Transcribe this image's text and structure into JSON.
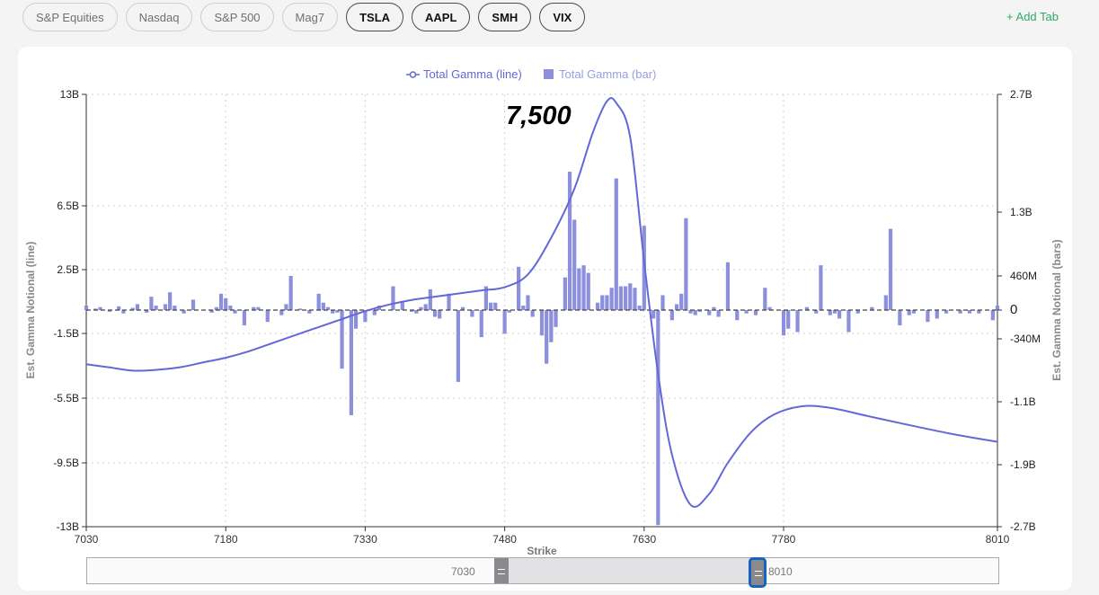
{
  "tabs": [
    {
      "label": "S&P Equities",
      "active": false
    },
    {
      "label": "Nasdaq",
      "active": false
    },
    {
      "label": "S&P 500",
      "active": false
    },
    {
      "label": "Mag7",
      "active": false
    },
    {
      "label": "TSLA",
      "active": true
    },
    {
      "label": "AAPL",
      "active": true
    },
    {
      "label": "SMH",
      "active": true
    },
    {
      "label": "VIX",
      "active": true
    }
  ],
  "add_tab_label": "+ Add Tab",
  "peak_label": "7,500",
  "slider": {
    "min_label": "7030",
    "max_label": "8010"
  },
  "colors": {
    "line": "#6468d6",
    "bar": "#8b8fdc",
    "zero_line": "#444444",
    "grid": "#cfcfd6",
    "add_tab": "#2ea86b"
  },
  "chart_data": {
    "type": "bar+line",
    "legend": [
      "Total Gamma (line)",
      "Total Gamma (bar)"
    ],
    "legend_position": "top-center",
    "xlabel": "Strike",
    "ylabel_left": "Est. Gamma Notional (line)",
    "ylabel_right": "Est. Gamma Notional (bars)",
    "x_ticks": [
      7030,
      7180,
      7330,
      7480,
      7630,
      7780,
      8010
    ],
    "xlim": [
      7030,
      8010
    ],
    "left_ticks": [
      {
        "v": 13,
        "label": "13B"
      },
      {
        "v": 6.5,
        "label": "6.5B"
      },
      {
        "v": 2.5,
        "label": "2.5B"
      },
      {
        "v": -1.5,
        "label": "-1.5B"
      },
      {
        "v": -5.5,
        "label": "-5.5B"
      },
      {
        "v": -9.5,
        "label": "-9.5B"
      },
      {
        "v": -13,
        "label": "-13B"
      }
    ],
    "right_ticks": [
      {
        "v": 2.7,
        "label": "2.7B"
      },
      {
        "v": 1.3,
        "label": "1.3B"
      },
      {
        "v": 0.46,
        "label": "460M"
      },
      {
        "v": 0,
        "label": "0"
      },
      {
        "v": -0.34,
        "label": "-340M"
      },
      {
        "v": -1.1,
        "label": "-1.1B"
      },
      {
        "v": -1.9,
        "label": "-1.9B"
      },
      {
        "v": -2.7,
        "label": "-2.7B"
      }
    ],
    "grid": "dotted",
    "line_series": {
      "name": "Total Gamma (line)",
      "points": [
        [
          7030,
          -3.4
        ],
        [
          7055,
          -3.6
        ],
        [
          7080,
          -3.8
        ],
        [
          7105,
          -3.75
        ],
        [
          7130,
          -3.6
        ],
        [
          7155,
          -3.3
        ],
        [
          7180,
          -3.0
        ],
        [
          7205,
          -2.6
        ],
        [
          7230,
          -2.1
        ],
        [
          7255,
          -1.6
        ],
        [
          7280,
          -1.1
        ],
        [
          7305,
          -0.6
        ],
        [
          7330,
          -0.1
        ],
        [
          7355,
          0.3
        ],
        [
          7380,
          0.6
        ],
        [
          7405,
          0.8
        ],
        [
          7430,
          1.0
        ],
        [
          7455,
          1.2
        ],
        [
          7480,
          1.4
        ],
        [
          7505,
          2.2
        ],
        [
          7530,
          4.5
        ],
        [
          7555,
          7.5
        ],
        [
          7575,
          10.8
        ],
        [
          7590,
          12.6
        ],
        [
          7600,
          12.5
        ],
        [
          7615,
          10.5
        ],
        [
          7630,
          3.0
        ],
        [
          7645,
          -4.0
        ],
        [
          7660,
          -9.0
        ],
        [
          7680,
          -11.8
        ],
        [
          7700,
          -11.2
        ],
        [
          7720,
          -9.5
        ],
        [
          7745,
          -7.6
        ],
        [
          7770,
          -6.5
        ],
        [
          7800,
          -6.0
        ],
        [
          7830,
          -6.1
        ],
        [
          7870,
          -6.6
        ],
        [
          7910,
          -7.1
        ],
        [
          7960,
          -7.7
        ],
        [
          8010,
          -8.2
        ]
      ]
    },
    "bar_series": {
      "name": "Total Gamma (bar)",
      "points": [
        [
          7030,
          0.06
        ],
        [
          7040,
          0.02
        ],
        [
          7045,
          0.04
        ],
        [
          7055,
          -0.02
        ],
        [
          7065,
          0.05
        ],
        [
          7070,
          -0.04
        ],
        [
          7080,
          0.03
        ],
        [
          7085,
          0.08
        ],
        [
          7095,
          -0.03
        ],
        [
          7100,
          0.18
        ],
        [
          7105,
          0.06
        ],
        [
          7115,
          0.08
        ],
        [
          7120,
          0.24
        ],
        [
          7125,
          0.06
        ],
        [
          7135,
          -0.04
        ],
        [
          7145,
          0.14
        ],
        [
          7165,
          -0.03
        ],
        [
          7170,
          0.04
        ],
        [
          7175,
          0.22
        ],
        [
          7180,
          0.16
        ],
        [
          7185,
          0.06
        ],
        [
          7190,
          -0.04
        ],
        [
          7200,
          -0.18
        ],
        [
          7210,
          0.04
        ],
        [
          7215,
          0.04
        ],
        [
          7225,
          -0.14
        ],
        [
          7240,
          -0.06
        ],
        [
          7245,
          0.08
        ],
        [
          7250,
          0.46
        ],
        [
          7260,
          0.02
        ],
        [
          7270,
          -0.04
        ],
        [
          7280,
          0.22
        ],
        [
          7285,
          0.1
        ],
        [
          7290,
          0.04
        ],
        [
          7295,
          -0.04
        ],
        [
          7300,
          -0.03
        ],
        [
          7305,
          -0.7
        ],
        [
          7315,
          -1.27
        ],
        [
          7320,
          -0.22
        ],
        [
          7330,
          -0.14
        ],
        [
          7340,
          -0.06
        ],
        [
          7345,
          0.06
        ],
        [
          7360,
          0.32
        ],
        [
          7370,
          0.12
        ],
        [
          7380,
          -0.02
        ],
        [
          7385,
          -0.04
        ],
        [
          7390,
          0.04
        ],
        [
          7395,
          0.08
        ],
        [
          7400,
          0.28
        ],
        [
          7405,
          -0.08
        ],
        [
          7410,
          -0.1
        ],
        [
          7420,
          0.22
        ],
        [
          7430,
          -0.86
        ],
        [
          7435,
          0.04
        ],
        [
          7445,
          -0.08
        ],
        [
          7455,
          -0.32
        ],
        [
          7460,
          0.32
        ],
        [
          7465,
          0.1
        ],
        [
          7470,
          0.1
        ],
        [
          7480,
          -0.28
        ],
        [
          7485,
          -0.03
        ],
        [
          7495,
          0.58
        ],
        [
          7500,
          0.06
        ],
        [
          7505,
          0.2
        ],
        [
          7510,
          -0.08
        ],
        [
          7520,
          -0.3
        ],
        [
          7525,
          -0.64
        ],
        [
          7530,
          -0.38
        ],
        [
          7535,
          -0.2
        ],
        [
          7545,
          0.44
        ],
        [
          7550,
          1.78
        ],
        [
          7555,
          1.2
        ],
        [
          7560,
          0.56
        ],
        [
          7565,
          0.6
        ],
        [
          7570,
          0.5
        ],
        [
          7580,
          0.1
        ],
        [
          7585,
          0.2
        ],
        [
          7590,
          0.2
        ],
        [
          7595,
          0.3
        ],
        [
          7600,
          1.7
        ],
        [
          7605,
          0.32
        ],
        [
          7610,
          0.32
        ],
        [
          7615,
          0.36
        ],
        [
          7620,
          0.3
        ],
        [
          7625,
          0.06
        ],
        [
          7630,
          1.12
        ],
        [
          7640,
          -0.1
        ],
        [
          7645,
          -2.68
        ],
        [
          7650,
          0.2
        ],
        [
          7660,
          -0.12
        ],
        [
          7665,
          0.08
        ],
        [
          7670,
          0.22
        ],
        [
          7675,
          1.22
        ],
        [
          7680,
          -0.04
        ],
        [
          7685,
          -0.06
        ],
        [
          7690,
          -0.02
        ],
        [
          7700,
          -0.06
        ],
        [
          7705,
          0.04
        ],
        [
          7710,
          -0.08
        ],
        [
          7720,
          0.64
        ],
        [
          7730,
          -0.12
        ],
        [
          7740,
          -0.04
        ],
        [
          7750,
          -0.06
        ],
        [
          7760,
          0.3
        ],
        [
          7765,
          0.04
        ],
        [
          7780,
          -0.3
        ],
        [
          7785,
          -0.22
        ],
        [
          7795,
          -0.26
        ],
        [
          7805,
          0.04
        ],
        [
          7815,
          -0.04
        ],
        [
          7820,
          0.6
        ],
        [
          7830,
          -0.06
        ],
        [
          7835,
          -0.04
        ],
        [
          7840,
          -0.1
        ],
        [
          7850,
          -0.26
        ],
        [
          7860,
          -0.04
        ],
        [
          7875,
          0.04
        ],
        [
          7890,
          0.2
        ],
        [
          7895,
          1.08
        ],
        [
          7905,
          -0.18
        ],
        [
          7915,
          -0.06
        ],
        [
          7920,
          -0.04
        ],
        [
          7935,
          -0.14
        ],
        [
          7945,
          -0.1
        ],
        [
          7955,
          -0.04
        ],
        [
          7970,
          -0.04
        ],
        [
          7980,
          -0.04
        ],
        [
          7990,
          -0.04
        ],
        [
          8005,
          -0.12
        ],
        [
          8010,
          0.06
        ]
      ]
    }
  }
}
